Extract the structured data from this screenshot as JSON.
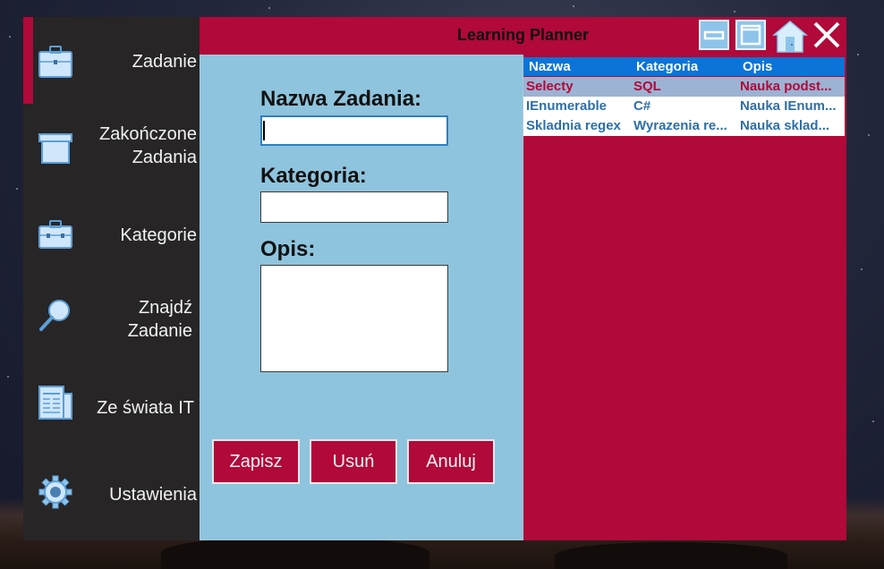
{
  "app": {
    "title": "Learning Planner"
  },
  "sidebar": {
    "items": [
      {
        "label_lines": [
          "Zadanie"
        ],
        "icon": "briefcase-icon",
        "active": true
      },
      {
        "label_lines": [
          "Zakończone",
          "Zadania"
        ],
        "icon": "archive-box-icon",
        "active": false
      },
      {
        "label_lines": [
          "Kategorie"
        ],
        "icon": "toolbox-icon",
        "active": false
      },
      {
        "label_lines": [
          "Znajdź",
          "Zadanie"
        ],
        "icon": "magnifier-icon",
        "active": false
      },
      {
        "label_lines": [
          "Ze świata IT"
        ],
        "icon": "newspaper-icon",
        "active": false
      },
      {
        "label_lines": [
          "Ustawienia"
        ],
        "icon": "gear-icon",
        "active": false
      }
    ]
  },
  "titlebar": {
    "buttons": [
      "minimize-icon",
      "maximize-icon",
      "home-icon",
      "close-icon"
    ]
  },
  "form": {
    "name_label": "Nazwa Zadania:",
    "name_value": "",
    "category_label": "Kategoria:",
    "category_value": "",
    "description_label": "Opis:",
    "description_value": "",
    "save_label": "Zapisz",
    "delete_label": "Usuń",
    "cancel_label": "Anuluj"
  },
  "tasks": {
    "columns": [
      "Nazwa",
      "Kategoria",
      "Opis"
    ],
    "rows": [
      {
        "name": "Selecty",
        "category": "SQL",
        "description": "Nauka podst...",
        "selected": true
      },
      {
        "name": "IEnumerable",
        "category": "C#",
        "description": "Nauka IEnum...",
        "selected": false
      },
      {
        "name": "Skladnia regex",
        "category": "Wyrazenia re...",
        "description": "Nauka sklad...",
        "selected": false
      }
    ]
  },
  "colors": {
    "accent": "#b0093a",
    "sidebar_bg": "#272526",
    "form_bg": "#8ec4dd",
    "list_header": "#0a74d8",
    "row_text": "#2f6fa6",
    "selected_row_bg": "#9cb3d3"
  }
}
